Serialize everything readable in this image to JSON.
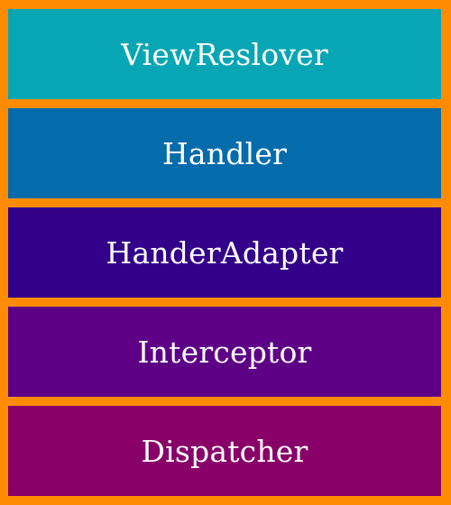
{
  "layers": [
    {
      "label": "ViewReslover",
      "color": "#07a6b4"
    },
    {
      "label": "Handler",
      "color": "#056cac"
    },
    {
      "label": "HanderAdapter",
      "color": "#33008a"
    },
    {
      "label": "Interceptor",
      "color": "#5e0086"
    },
    {
      "label": "Dispatcher",
      "color": "#880068"
    }
  ],
  "border_color": "#ff8c00"
}
